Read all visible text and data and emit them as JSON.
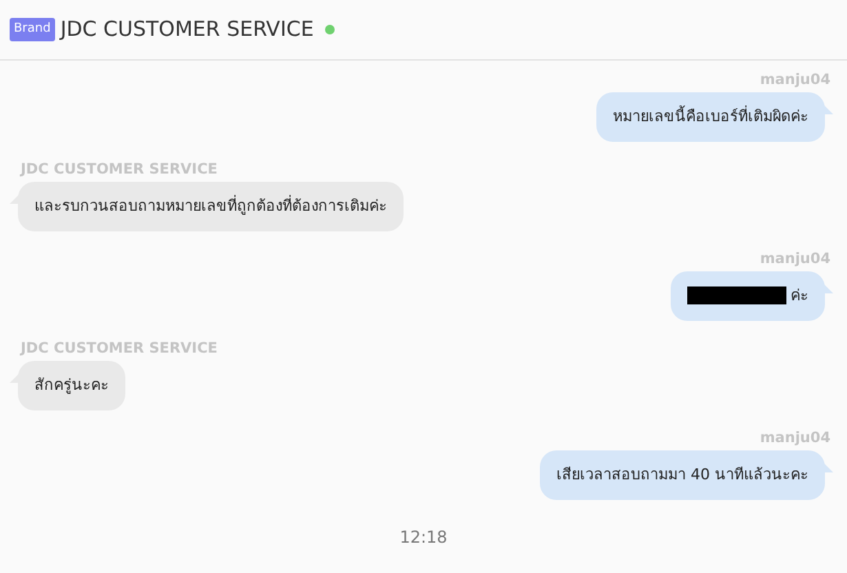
{
  "header": {
    "badge": "Brand",
    "title": "JDC CUSTOMER SERVICE",
    "online": true
  },
  "messages": [
    {
      "kind": "user",
      "sender": "manju04",
      "text": "หมายเลขนี้คือเบอร์ที่เติมผิดค่ะ",
      "redacted": false
    },
    {
      "kind": "agent",
      "sender": "JDC CUSTOMER SERVICE",
      "text": "และรบกวนสอบถามหมายเลขที่ถูกต้องที่ต้องการเติมค่ะ",
      "redacted": false
    },
    {
      "kind": "user",
      "sender": "manju04",
      "text": "ค่ะ",
      "redacted": true
    },
    {
      "kind": "agent",
      "sender": "JDC CUSTOMER SERVICE",
      "text": "สักครู่นะคะ",
      "redacted": false
    },
    {
      "kind": "user",
      "sender": "manju04",
      "text": "เสียเวลาสอบถามมา 40 นาทีแล้วนะคะ",
      "redacted": false
    }
  ],
  "time": "12:18"
}
